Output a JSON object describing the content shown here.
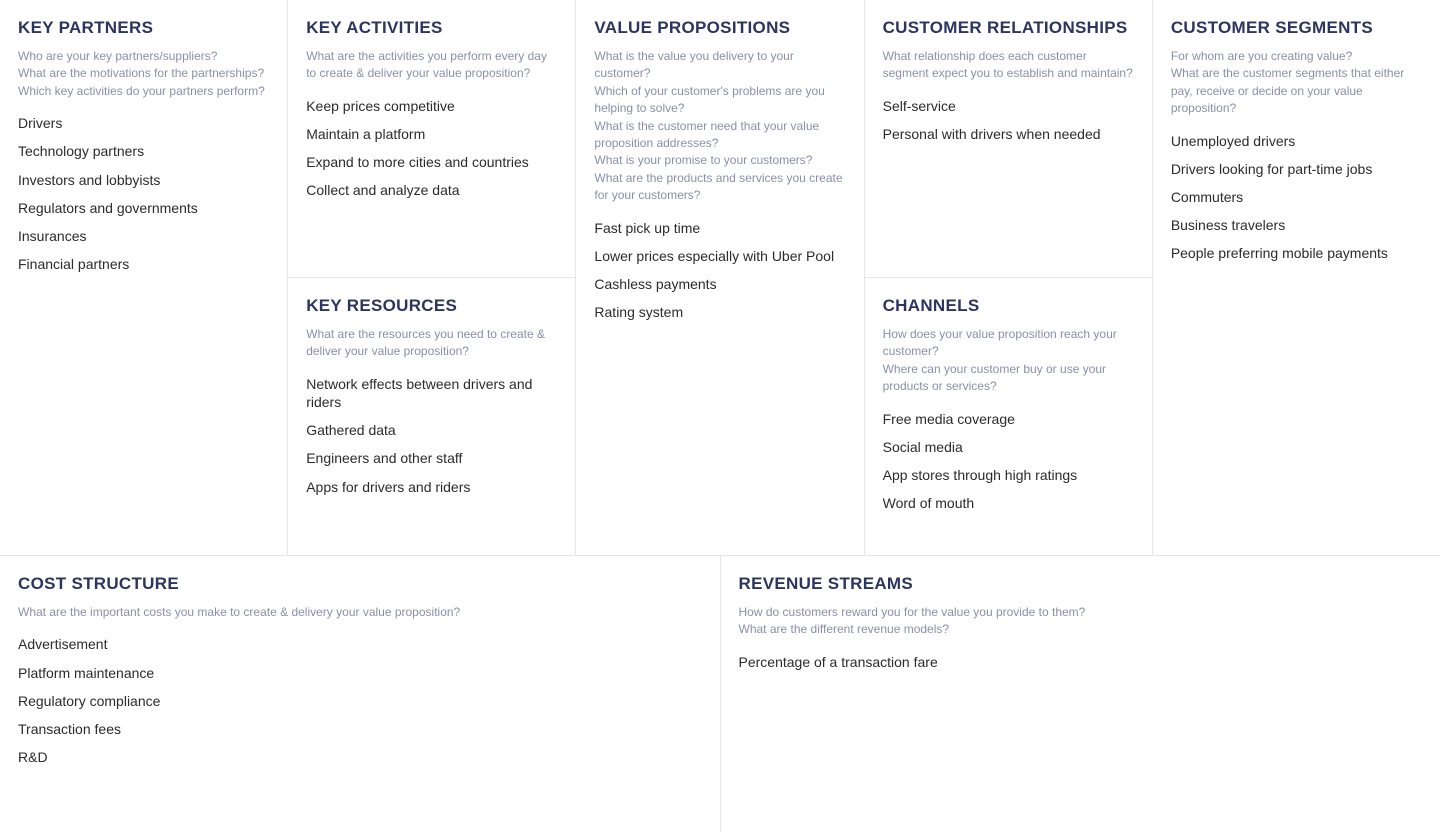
{
  "sections": {
    "key_partners": {
      "title": "KEY PARTNERS",
      "prompts": [
        "Who are your key partners/suppliers?",
        "What are the motivations for the partnerships?",
        "Which key activities do your partners perform?"
      ],
      "items": [
        "Drivers",
        "Technology partners",
        "Investors and lobbyists",
        "Regulators and governments",
        "Insurances",
        "Financial partners"
      ]
    },
    "key_activities": {
      "title": "KEY ACTIVITIES",
      "prompts": [
        "What are the activities you perform every day to create & deliver your value proposition?"
      ],
      "items": [
        "Keep prices competitive",
        "Maintain a platform",
        "Expand to more cities and countries",
        "Collect and analyze data"
      ]
    },
    "key_resources": {
      "title": "KEY RESOURCES",
      "prompts": [
        "What are the resources you need to create & deliver your value proposition?"
      ],
      "items": [
        "Network effects between drivers and riders",
        "Gathered data",
        "Engineers and other staff",
        "Apps for drivers and riders"
      ]
    },
    "value_propositions": {
      "title": "VALUE PROPOSITIONS",
      "prompts": [
        "What is the value you delivery to your customer?",
        "Which of your customer's problems are you helping to solve?",
        "What is the customer need that your value proposition addresses?",
        "What is your promise to your customers?",
        "What are the products and services you create for your customers?"
      ],
      "items": [
        "Fast pick up time",
        "Lower prices especially with Uber Pool",
        "Cashless payments",
        "Rating system"
      ]
    },
    "customer_relationships": {
      "title": "CUSTOMER RELATIONSHIPS",
      "prompts": [
        "What relationship does each customer segment expect you to establish and maintain?"
      ],
      "items": [
        "Self-service",
        "Personal with drivers when needed"
      ]
    },
    "channels": {
      "title": "CHANNELS",
      "prompts": [
        "How does your value proposition reach your customer?",
        "Where can your customer buy or use your products or services?"
      ],
      "items": [
        "Free media coverage",
        "Social media",
        "App stores through high ratings",
        "Word of mouth"
      ]
    },
    "customer_segments": {
      "title": "CUSTOMER SEGMENTS",
      "prompts": [
        "For whom are you creating value?",
        "What are the customer segments that either pay, receive or decide on your value proposition?"
      ],
      "items": [
        "Unemployed drivers",
        "Drivers looking for part-time jobs",
        "Commuters",
        "Business travelers",
        "People preferring mobile payments"
      ]
    },
    "cost_structure": {
      "title": "COST STRUCTURE",
      "prompts": [
        "What are the important costs you make to create & delivery your value proposition?"
      ],
      "items": [
        "Advertisement",
        "Platform maintenance",
        "Regulatory compliance",
        "Transaction fees",
        "R&D"
      ]
    },
    "revenue_streams": {
      "title": "REVENUE STREAMS",
      "prompts": [
        "How do customers reward you for the value you provide to them?",
        "What are the different revenue models?"
      ],
      "items": [
        "Percentage of a transaction fare"
      ]
    }
  }
}
